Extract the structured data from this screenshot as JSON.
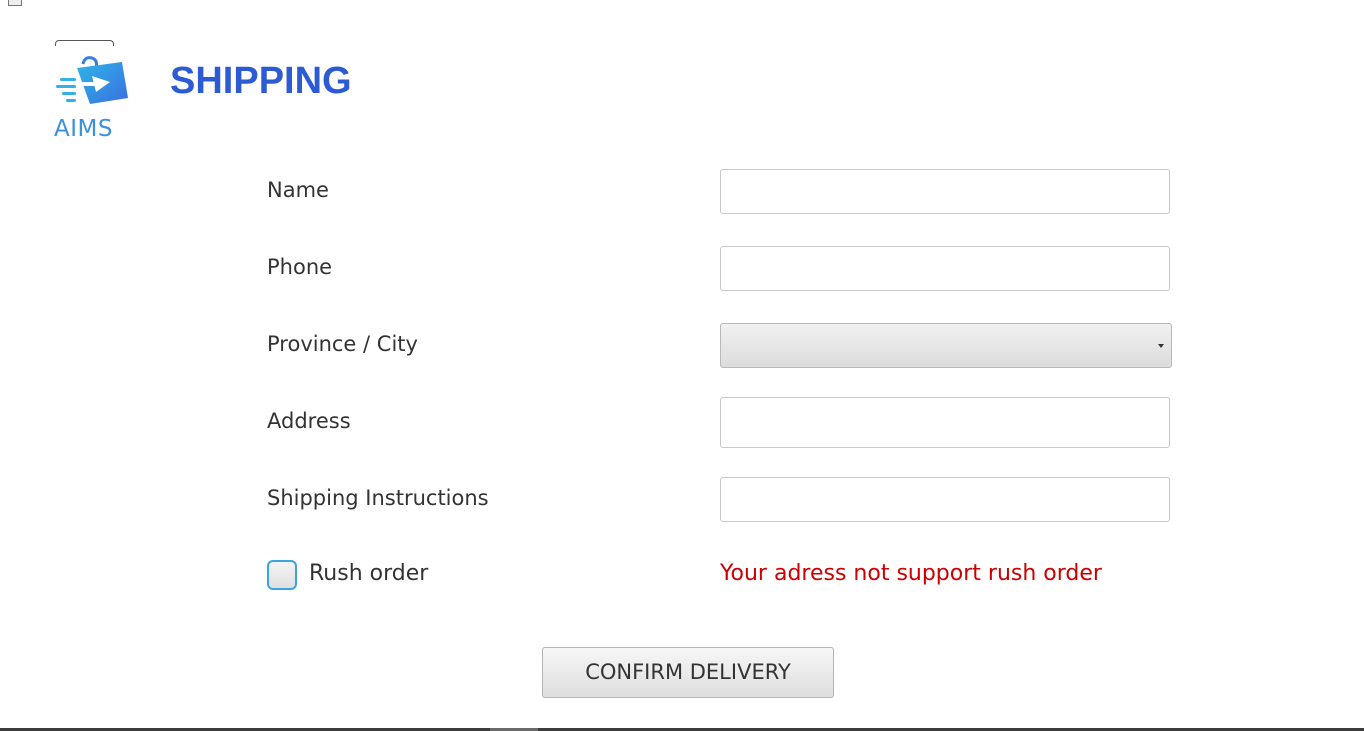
{
  "header": {
    "logo_text": "AIMS",
    "title": "SHIPPING"
  },
  "form": {
    "name_label": "Name",
    "name_value": "",
    "phone_label": "Phone",
    "phone_value": "",
    "province_label": "Province / City",
    "province_value": "",
    "address_label": "Address",
    "address_value": "",
    "instructions_label": "Shipping Instructions",
    "instructions_value": "",
    "rush_label": "Rush order",
    "rush_checked": false,
    "rush_error": "Your adress not support rush order",
    "confirm_label": "CONFIRM DELIVERY"
  },
  "icons": {
    "logo": "shopping-bag-arrow-icon",
    "dropdown": "chevron-down-icon"
  },
  "colors": {
    "title": "#2d5bd4",
    "error": "#cc0000",
    "logo": "#3d8fe0",
    "checkbox_border": "#3aa4df"
  }
}
